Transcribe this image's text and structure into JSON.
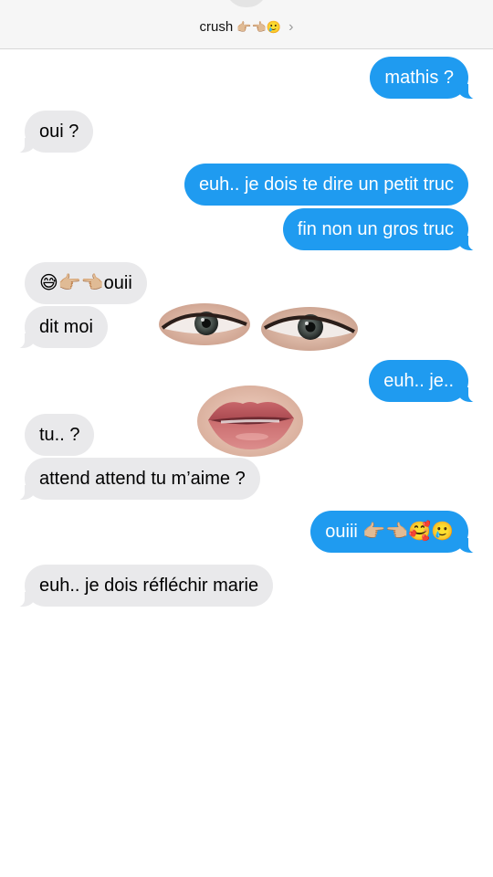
{
  "header": {
    "contact_name": "crush",
    "emoji": "👉🏼👈🏼🥲",
    "chevron": "›"
  },
  "messages": [
    {
      "from": "me",
      "text": "mathis ?"
    },
    {
      "from": "them",
      "text": "oui ?"
    },
    {
      "from": "me",
      "text": "euh.. je dois te dire un petit truc"
    },
    {
      "from": "me",
      "text": "fin non un gros truc"
    },
    {
      "from": "them",
      "text": "😅👉🏼👈🏼ouii"
    },
    {
      "from": "them",
      "text": "dit moi"
    },
    {
      "from": "me",
      "text": "euh.. je.."
    },
    {
      "from": "them",
      "text": "tu.. ?"
    },
    {
      "from": "them",
      "text": "attend attend tu m’aime ?"
    },
    {
      "from": "me",
      "text": "ouiii 👉🏼👈🏼🥰🥲"
    },
    {
      "from": "them",
      "text": "euh.. je dois réfléchir marie"
    }
  ],
  "colors": {
    "outgoing_bubble": "#1f9bf0",
    "incoming_bubble": "#e9e9eb",
    "header_bg": "#f6f6f6"
  },
  "stickers": [
    "left-eye",
    "right-eye",
    "mouth"
  ]
}
